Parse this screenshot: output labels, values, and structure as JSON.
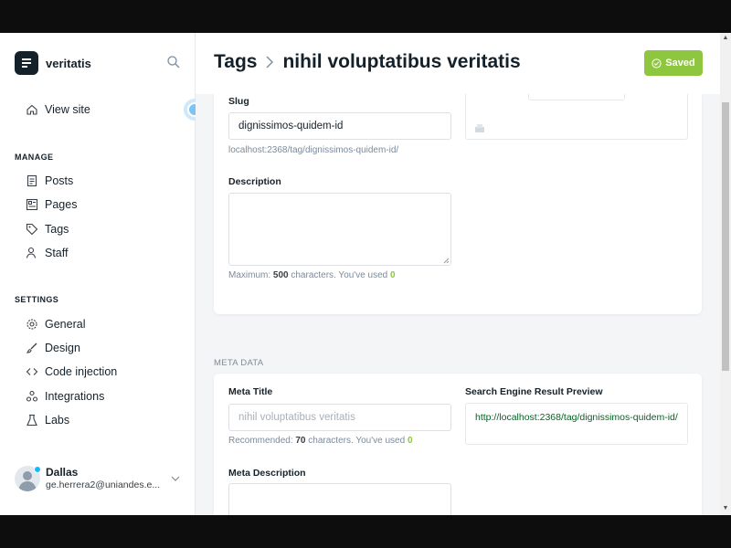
{
  "sidebar": {
    "brand": "veritatis",
    "view_site": "View site",
    "manage_heading": "MANAGE",
    "manage_items": [
      "Posts",
      "Pages",
      "Tags",
      "Staff"
    ],
    "settings_heading": "SETTINGS",
    "settings_items": [
      "General",
      "Design",
      "Code injection",
      "Integrations",
      "Labs"
    ],
    "user": {
      "name": "Dallas",
      "email": "ge.herrera2@uniandes.e..."
    }
  },
  "header": {
    "crumb_parent": "Tags",
    "crumb_current": "nihil voluptatibus veritatis",
    "saved_label": "Saved"
  },
  "tag_form": {
    "slug_label": "Slug",
    "slug_value": "dignissimos-quidem-id",
    "slug_url": "localhost:2368/tag/dignissimos-quidem-id/",
    "description_label": "Description",
    "description_value": "",
    "description_hint_prefix": "Maximum:",
    "description_max": "500",
    "description_hint_mid": "characters. You've used",
    "description_used": "0"
  },
  "meta_data": {
    "heading": "META DATA",
    "meta_title_label": "Meta Title",
    "meta_title_placeholder": "nihil voluptatibus veritatis",
    "meta_title_hint_prefix": "Recommended:",
    "meta_title_recommended": "70",
    "meta_title_hint_mid": "characters. You've used",
    "meta_title_used": "0",
    "serp_label": "Search Engine Result Preview",
    "serp_url": "http://localhost:2368/tag/dignissimos-quidem-id/",
    "meta_description_label": "Meta Description"
  },
  "colors": {
    "accent_green": "#8ec63f",
    "dark": "#15212a",
    "serp_url_green": "#006621"
  }
}
